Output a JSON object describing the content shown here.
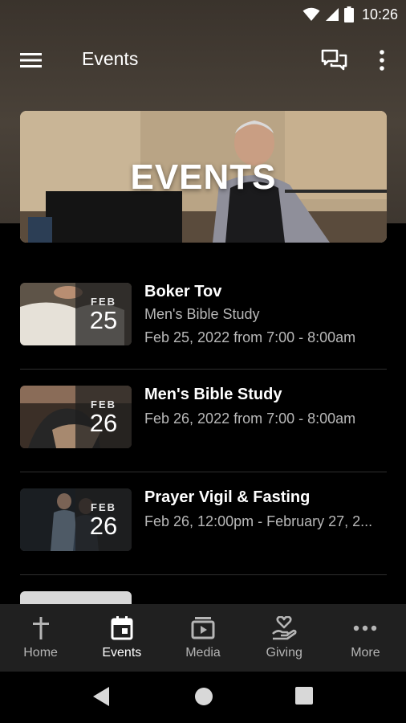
{
  "status_bar": {
    "time": "10:26"
  },
  "app_bar": {
    "title": "Events"
  },
  "banner": {
    "title": "EVENTS"
  },
  "events": [
    {
      "month": "FEB",
      "day": "25",
      "title": "Boker Tov",
      "subtitle": "Men's Bible Study",
      "datetime": "Feb 25, 2022 from 7:00 - 8:00am"
    },
    {
      "month": "FEB",
      "day": "26",
      "title": "Men's Bible Study",
      "datetime": "Feb 26, 2022 from 7:00 - 8:00am"
    },
    {
      "month": "FEB",
      "day": "26",
      "title": "Prayer Vigil & Fasting",
      "datetime": "Feb 26, 12:00pm - February 27, 2..."
    }
  ],
  "bottom_nav": [
    {
      "label": "Home",
      "icon": "cross-icon"
    },
    {
      "label": "Events",
      "icon": "calendar-icon",
      "active": true
    },
    {
      "label": "Media",
      "icon": "media-icon"
    },
    {
      "label": "Giving",
      "icon": "giving-icon"
    },
    {
      "label": "More",
      "icon": "more-horiz-icon"
    }
  ],
  "colors": {
    "background": "#000000",
    "nav_bg": "#202020",
    "active": "#ffffff",
    "inactive": "#b5b5b5"
  }
}
